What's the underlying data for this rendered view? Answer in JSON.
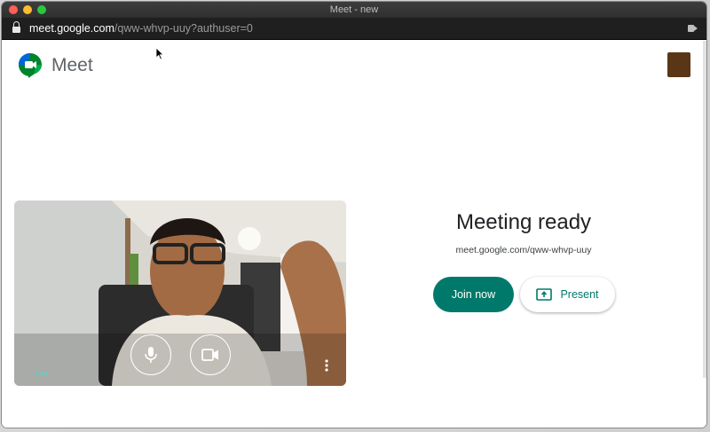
{
  "window": {
    "title": "Meet - new"
  },
  "address_bar": {
    "host": "meet.google.com",
    "path": "/qww-whvp-uuy?authuser=0"
  },
  "header": {
    "app_name": "Meet",
    "brand_color": "#00832d"
  },
  "preview": {
    "mic_icon": "microphone-icon",
    "camera_icon": "video-camera-icon",
    "more_icon": "more-vert-icon",
    "effects_icon": "dots-icon"
  },
  "join_panel": {
    "title": "Meeting ready",
    "meeting_url": "meet.google.com/qww-whvp-uuy",
    "join_label": "Join now",
    "present_label": "Present",
    "accent_color": "#00796b"
  }
}
